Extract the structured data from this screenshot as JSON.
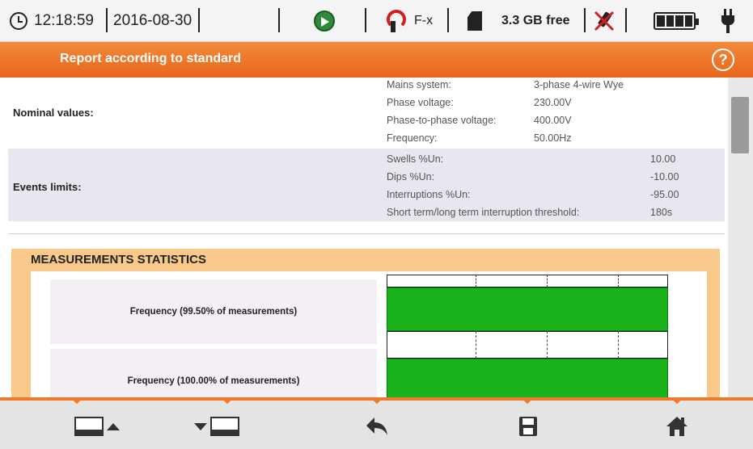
{
  "status": {
    "time": "12:18:59",
    "date": "2016-08-30",
    "clamp_label": "F-x",
    "storage": "3.3 GB free"
  },
  "header": {
    "title": "Report according to standard",
    "help_label": "?"
  },
  "nominal": {
    "label": "Nominal values:",
    "items": [
      {
        "key": "Mains system:",
        "value": "3-phase 4-wire Wye"
      },
      {
        "key": "Phase voltage:",
        "value": "230.00V"
      },
      {
        "key": "Phase-to-phase voltage:",
        "value": "400.00V"
      },
      {
        "key": "Frequency:",
        "value": "50.00Hz"
      }
    ]
  },
  "events": {
    "label": "Events limits:",
    "items": [
      {
        "key": "Swells %Un:",
        "value": "10.00"
      },
      {
        "key": "Dips %Un:",
        "value": "-10.00"
      },
      {
        "key": "Interruptions %Un:",
        "value": "-95.00"
      },
      {
        "key": "Short term/long term interruption threshold:",
        "value": "180s"
      }
    ]
  },
  "stats": {
    "title": "MEASUREMENTS STATISTICS",
    "rows": [
      {
        "label": "Frequency (99.50% of measurements)"
      },
      {
        "label": "Frequency (100.00% of measurements)"
      }
    ],
    "bar_color": "#1bb31b"
  },
  "accent_color": "#ef7a2a"
}
